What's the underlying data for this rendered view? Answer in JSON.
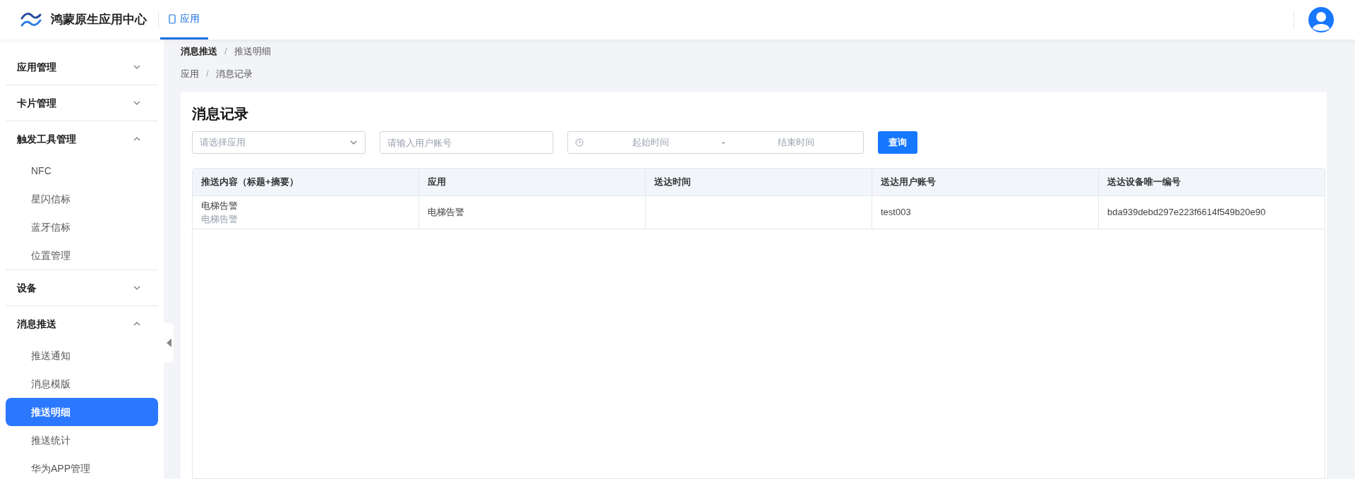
{
  "header": {
    "title": "鸿蒙原生应用中心",
    "tabs": [
      {
        "label": "应用",
        "selected": true
      }
    ]
  },
  "sidebar": {
    "groups": [
      {
        "label": "应用管理",
        "expanded": false
      },
      {
        "label": "卡片管理",
        "expanded": false
      },
      {
        "label": "触发工具管理",
        "expanded": true,
        "children": [
          {
            "label": "NFC",
            "selected": false
          },
          {
            "label": "星闪信标",
            "selected": false
          },
          {
            "label": "蓝牙信标",
            "selected": false
          },
          {
            "label": "位置管理",
            "selected": false
          }
        ]
      },
      {
        "label": "设备",
        "expanded": false
      },
      {
        "label": "消息推送",
        "expanded": true,
        "children": [
          {
            "label": "推送通知",
            "selected": false
          },
          {
            "label": "消息模版",
            "selected": false
          },
          {
            "label": "推送明细",
            "selected": true
          },
          {
            "label": "推送统计",
            "selected": false
          },
          {
            "label": "华为APP管理",
            "selected": false
          }
        ]
      }
    ]
  },
  "breadcrumbs": [
    {
      "separator": "/",
      "items": [
        "消息推送",
        "推送明细"
      ]
    },
    {
      "separator": "/",
      "items": [
        "应用",
        "消息记录"
      ]
    }
  ],
  "card": {
    "title": "消息记录",
    "filters": {
      "app_select": {
        "placeholder": "请选择应用"
      },
      "account": {
        "placeholder": "请输入用户账号"
      },
      "date_range": {
        "start_placeholder": "起始时间",
        "separator": "-",
        "end_placeholder": "结束时间"
      },
      "button": "查询"
    },
    "table": {
      "columns": [
        "推送内容（标题+摘要）",
        "应用",
        "送达时间",
        "送达用户账号",
        "送达设备唯一编号"
      ],
      "rows": [
        {
          "title": "电梯告警",
          "summary": "电梯告警",
          "app": "电梯告警",
          "account": "test003",
          "device": "bda939debd297e223f6614f549b20e90"
        }
      ]
    }
  }
}
